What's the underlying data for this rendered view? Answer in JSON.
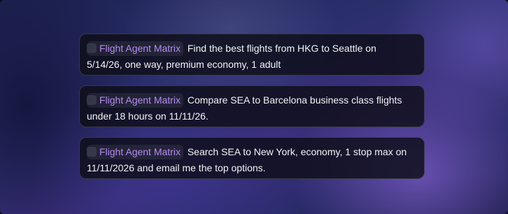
{
  "prompts": [
    {
      "agent": "Flight Agent Matrix",
      "agent_icon": "agent-icon",
      "text": "Find the best flights from HKG to Seattle on 5/14/26, one way, premium economy, 1 adult"
    },
    {
      "agent": "Flight Agent Matrix",
      "agent_icon": "agent-icon",
      "text": "Compare SEA to Barcelona business class flights under 18 hours on 11/11/26."
    },
    {
      "agent": "Flight Agent Matrix",
      "agent_icon": "agent-icon",
      "text": "Search SEA to New York, economy, 1 stop max on 11/11/2026 and email me the top options."
    }
  ],
  "colors": {
    "agent_name": "#b48cf0",
    "card_background": "#0e0e18",
    "text": "#f2f2f6"
  }
}
